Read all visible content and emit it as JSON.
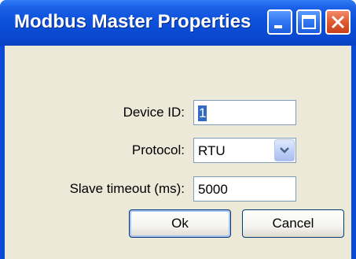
{
  "window": {
    "title": "Modbus Master Properties",
    "controls": [
      "minimize-icon",
      "maximize-icon",
      "close-icon"
    ]
  },
  "form": {
    "device_id": {
      "label": "Device ID:",
      "value": "1"
    },
    "protocol": {
      "label": "Protocol:",
      "selected": "RTU"
    },
    "slave_timeout": {
      "label": "Slave timeout (ms):",
      "value": "5000"
    }
  },
  "buttons": {
    "ok": "Ok",
    "cancel": "Cancel"
  },
  "colors": {
    "titlebar": "#0a4ad8",
    "client": "#ece9d8",
    "close_button": "#e05a32",
    "selection": "#316ac5"
  }
}
